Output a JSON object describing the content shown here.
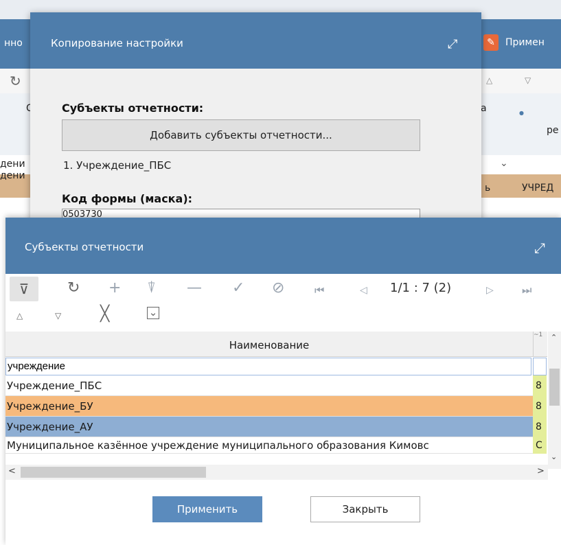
{
  "background": {
    "title_left": "нно",
    "apply_label": "Примен",
    "header_left": "С",
    "header_mid": "а",
    "header_right": "ре",
    "row_left_1": "дени",
    "row_left_2": "дени",
    "row_right": "УЧРЕД",
    "row_right_short": "ь"
  },
  "dialog_copy": {
    "title": "Копирование настройки",
    "subjects_label": "Субъекты отчетности:",
    "add_button": "Добавить субъекты отчетности...",
    "subject_items": [
      "1.  Учреждение_ПБС"
    ],
    "form_code_label": "Код формы (маска):",
    "form_code_value": "0503730"
  },
  "dialog_subjects": {
    "title": "Субъекты отчетности",
    "pager": "1/1 : 7 (2)",
    "column_header": "Наименование",
    "column_header2_marker": "~1",
    "filter_value": "учреждение",
    "rows": [
      {
        "name": "Учреждение_ПБС",
        "code": "8",
        "state": "normal"
      },
      {
        "name": "Учреждение_БУ",
        "code": "8",
        "state": "current"
      },
      {
        "name": "Учреждение_АУ",
        "code": "8",
        "state": "selected"
      },
      {
        "name": "Муниципальное казённое учреждение муниципального образования Кимовс",
        "code": "C",
        "state": "normal"
      }
    ],
    "apply_button": "Применить",
    "close_button": "Закрыть"
  },
  "colors": {
    "header_blue": "#4e7dab",
    "row_current": "#f6b97c",
    "row_selected": "#8eaed3",
    "code_cell": "#e4ee9a",
    "apply_orange": "#e8693a"
  }
}
